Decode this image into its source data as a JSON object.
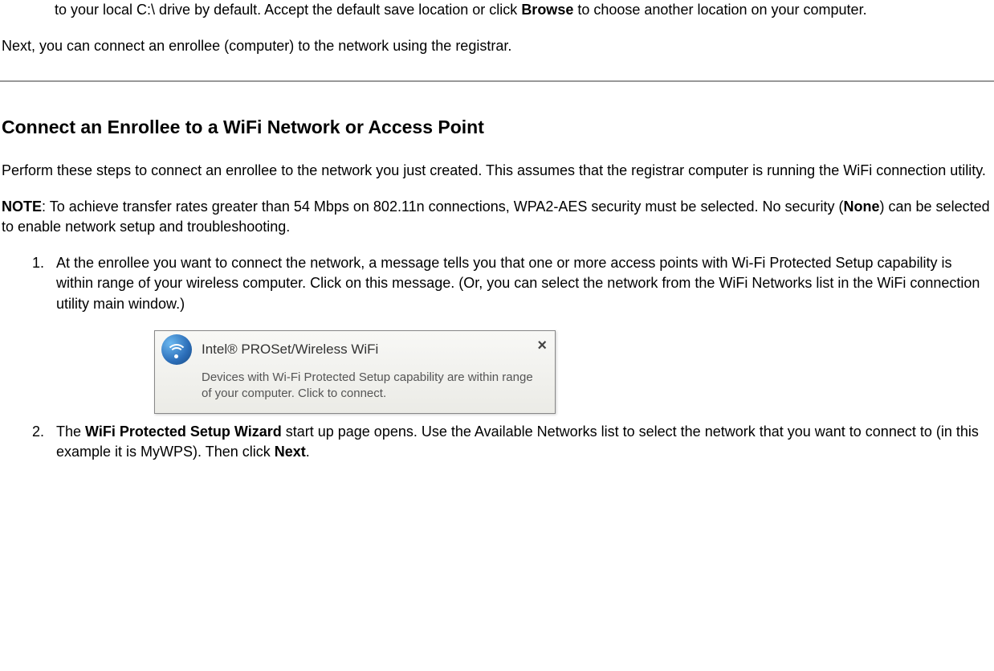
{
  "intro": {
    "fragment_before": "to your local C:\\ drive by default. Accept the default save location or click ",
    "browse": "Browse",
    "fragment_after": " to choose another location on your computer."
  },
  "lead_para": "Next, you can connect an enrollee (computer) to the network using the registrar.",
  "section_heading": "Connect an Enrollee to a WiFi Network or Access Point",
  "perform_para": "Perform these steps to connect an enrollee to the network you just created. This assumes that the registrar computer is running the WiFi connection utility.",
  "note": {
    "label": "NOTE",
    "before": ": To achieve transfer rates greater than 54 Mbps on 802.11n connections, WPA2-AES security must be selected. No security (",
    "none": "None",
    "after": ") can be selected to enable network setup and troubleshooting."
  },
  "steps": {
    "item1": "At the enrollee you want to connect the network, a message tells you that one or more access points with Wi-Fi Protected Setup capability is within range of your wireless computer. Click on this message. (Or, you can select the network from the WiFi Networks list in the WiFi connection utility main window.)",
    "item2_before": "The ",
    "item2_wizard": "WiFi Protected Setup Wizard",
    "item2_mid": " start up page opens. Use the Available Networks list to select the network that you want to connect to (in this example it is MyWPS). Then click ",
    "item2_next": "Next",
    "item2_after": "."
  },
  "notification": {
    "title": "Intel® PROSet/Wireless WiFi",
    "body": "Devices with Wi-Fi Protected Setup capability are within range of your computer. Click to connect.",
    "close": "×"
  }
}
